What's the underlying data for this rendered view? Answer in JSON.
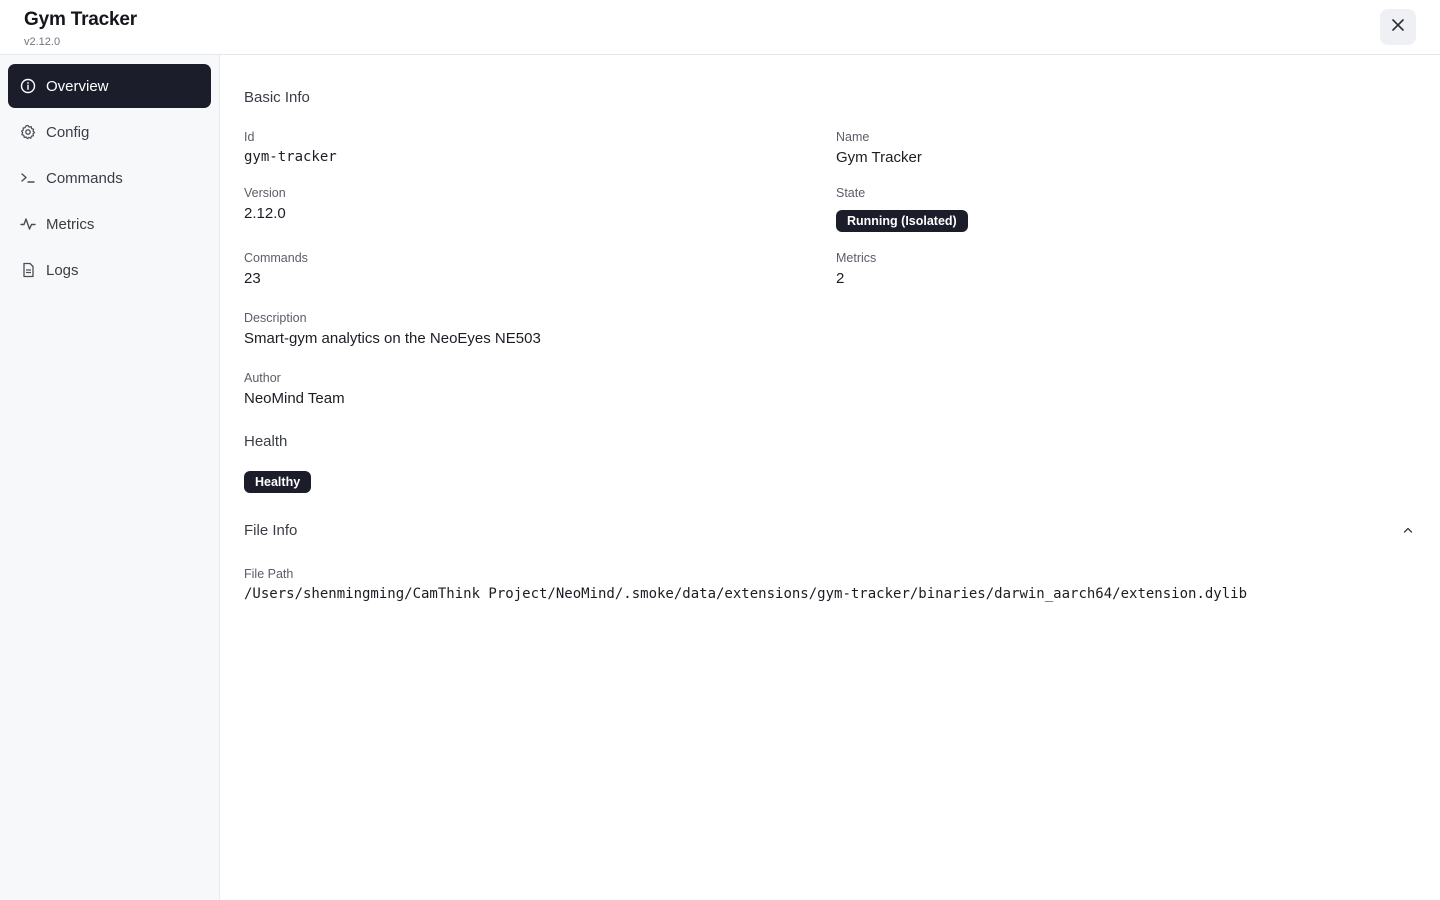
{
  "header": {
    "title": "Gym Tracker",
    "version": "v2.12.0",
    "close_icon": "close-icon"
  },
  "sidebar": {
    "items": [
      {
        "label": "Overview",
        "icon": "info-icon",
        "active": true
      },
      {
        "label": "Config",
        "icon": "gear-icon",
        "active": false
      },
      {
        "label": "Commands",
        "icon": "terminal-icon",
        "active": false
      },
      {
        "label": "Metrics",
        "icon": "activity-icon",
        "active": false
      },
      {
        "label": "Logs",
        "icon": "file-icon",
        "active": false
      }
    ]
  },
  "basic_info": {
    "title": "Basic Info",
    "id_label": "Id",
    "id_value": "gym-tracker",
    "name_label": "Name",
    "name_value": "Gym Tracker",
    "version_label": "Version",
    "version_value": "2.12.0",
    "state_label": "State",
    "state_value": "Running (Isolated)",
    "commands_label": "Commands",
    "commands_value": "23",
    "metrics_label": "Metrics",
    "metrics_value": "2",
    "description_label": "Description",
    "description_value": "Smart-gym analytics on the NeoEyes NE503",
    "author_label": "Author",
    "author_value": "NeoMind Team"
  },
  "health": {
    "title": "Health",
    "status": "Healthy"
  },
  "file_info": {
    "title": "File Info",
    "expanded": true,
    "toggle_icon": "chevron-up-icon",
    "file_path_label": "File Path",
    "file_path_value": "/Users/shenmingming/CamThink Project/NeoMind/.smoke/data/extensions/gym-tracker/binaries/darwin_aarch64/extension.dylib"
  },
  "colors": {
    "accent": "#1b1d2a",
    "sidebar_bg": "#f7f8fa",
    "border": "#e7e8ec"
  }
}
